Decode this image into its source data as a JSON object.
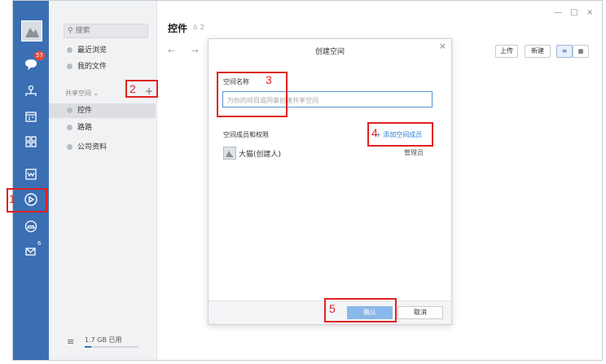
{
  "window": {
    "controls": [
      "—",
      "□",
      "×"
    ]
  },
  "nav": {
    "avatar_label": "avatar",
    "chat_badge": "57",
    "mail_badge": "6",
    "icons": [
      "chat-icon",
      "contacts-icon",
      "calendar-icon",
      "apps-icon",
      "mail-icon",
      "drive-icon",
      "cloud-icon",
      "mail-badge-icon"
    ]
  },
  "sidebar": {
    "search_placeholder": "搜索",
    "recent": "最近浏览",
    "my_files": "我的文件",
    "shared_label": "共享空间 ⌄",
    "shared_items": [
      "控件",
      "路路",
      "公司资料"
    ],
    "storage": "1.7 GB 已用"
  },
  "main": {
    "title": "控件",
    "member_count": "2",
    "nav_arrows": "← →",
    "upload_label": "上传",
    "new_label": "新建"
  },
  "modal": {
    "title": "创建空间",
    "name_label": "空间名称",
    "name_placeholder": "为你的项目或同事创建共享空间",
    "members_label": "空间成员和权限",
    "add_member": "+ 添加空间成员",
    "member_name": "大猫(创建人)",
    "member_role": "管理员",
    "confirm": "确认",
    "cancel": "取消"
  },
  "annotations": {
    "n1": "1",
    "n2": "2",
    "n3": "3",
    "n4": "4",
    "n5": "5"
  },
  "colors": {
    "nav_bg": "#3a6fb4",
    "confirm_bg": "#8ab8e8",
    "link": "#2b79d6",
    "annotation": "#e02020"
  }
}
